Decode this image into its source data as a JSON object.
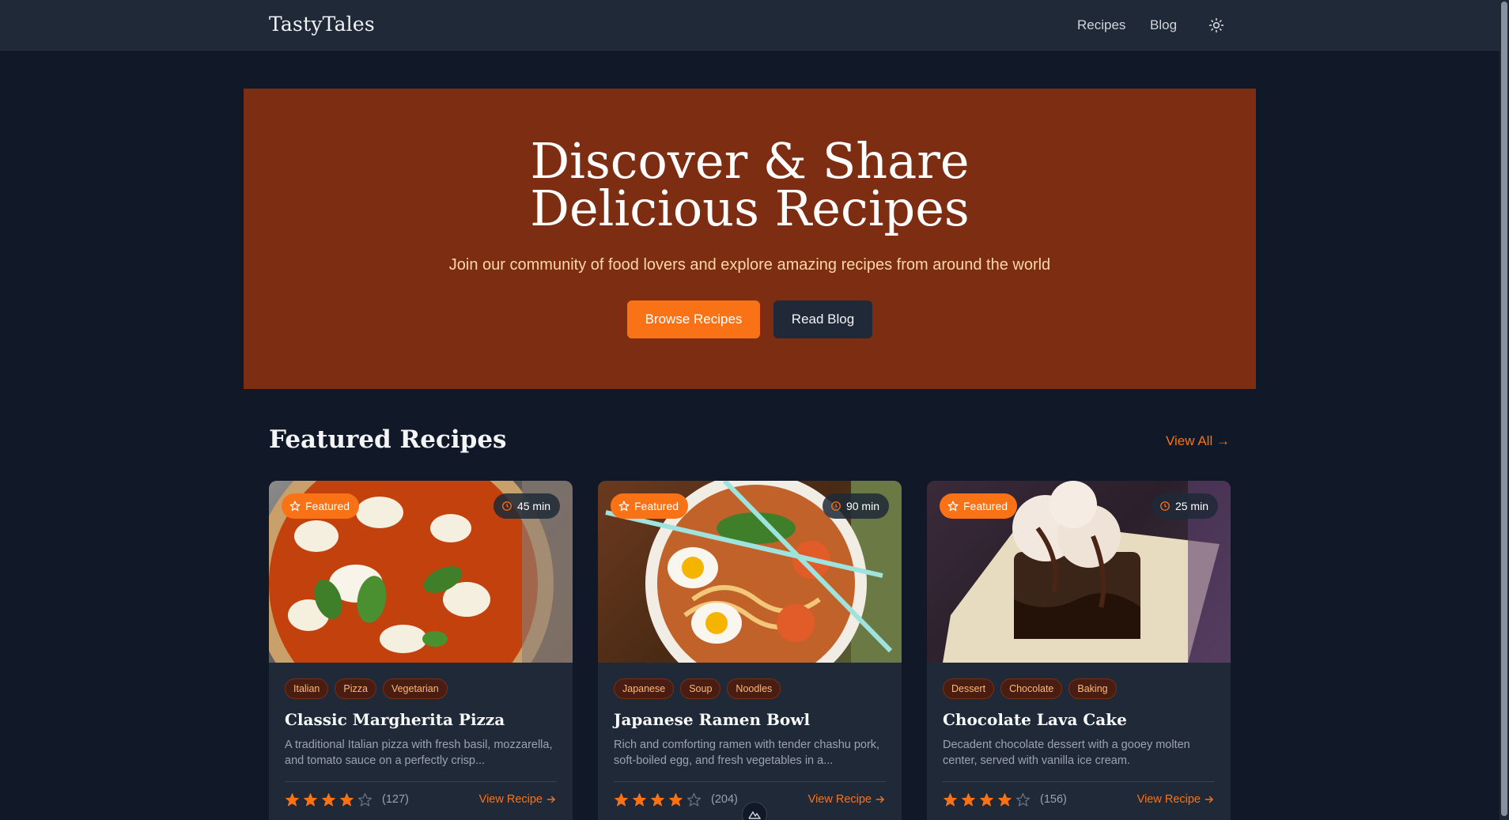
{
  "header": {
    "logo": "TastyTales",
    "nav": {
      "recipes": "Recipes",
      "blog": "Blog"
    },
    "theme_toggle_icon": "sun-icon"
  },
  "hero": {
    "title_line1": "Discover & Share",
    "title_line2": "Delicious Recipes",
    "subtitle": "Join our community of food lovers and explore amazing recipes from around the world",
    "browse_label": "Browse Recipes",
    "blog_label": "Read Blog"
  },
  "featured": {
    "title": "Featured Recipes",
    "view_all": "View All →",
    "cards": [
      {
        "badge": "Featured",
        "time": "45 min",
        "tags": [
          "Italian",
          "Pizza",
          "Vegetarian"
        ],
        "title": "Classic Margherita Pizza",
        "description": "A traditional Italian pizza with fresh basil, mozzarella, and tomato sauce on a perfectly crisp...",
        "rating": 4,
        "rating_count": "(127)",
        "link": "View Recipe"
      },
      {
        "badge": "Featured",
        "time": "90 min",
        "tags": [
          "Japanese",
          "Soup",
          "Noodles"
        ],
        "title": "Japanese Ramen Bowl",
        "description": "Rich and comforting ramen with tender chashu pork, soft-boiled egg, and fresh vegetables in a...",
        "rating": 4,
        "rating_count": "(204)",
        "link": "View Recipe"
      },
      {
        "badge": "Featured",
        "time": "25 min",
        "tags": [
          "Dessert",
          "Chocolate",
          "Baking"
        ],
        "title": "Chocolate Lava Cake",
        "description": "Decadent chocolate dessert with a gooey molten center, served with vanilla ice cream.",
        "rating": 4,
        "rating_count": "(156)",
        "link": "View Recipe"
      }
    ]
  },
  "colors": {
    "accent": "#f97316",
    "hero_bg": "#7c2d12",
    "page_bg": "#111827",
    "card_bg": "#1f2937"
  }
}
